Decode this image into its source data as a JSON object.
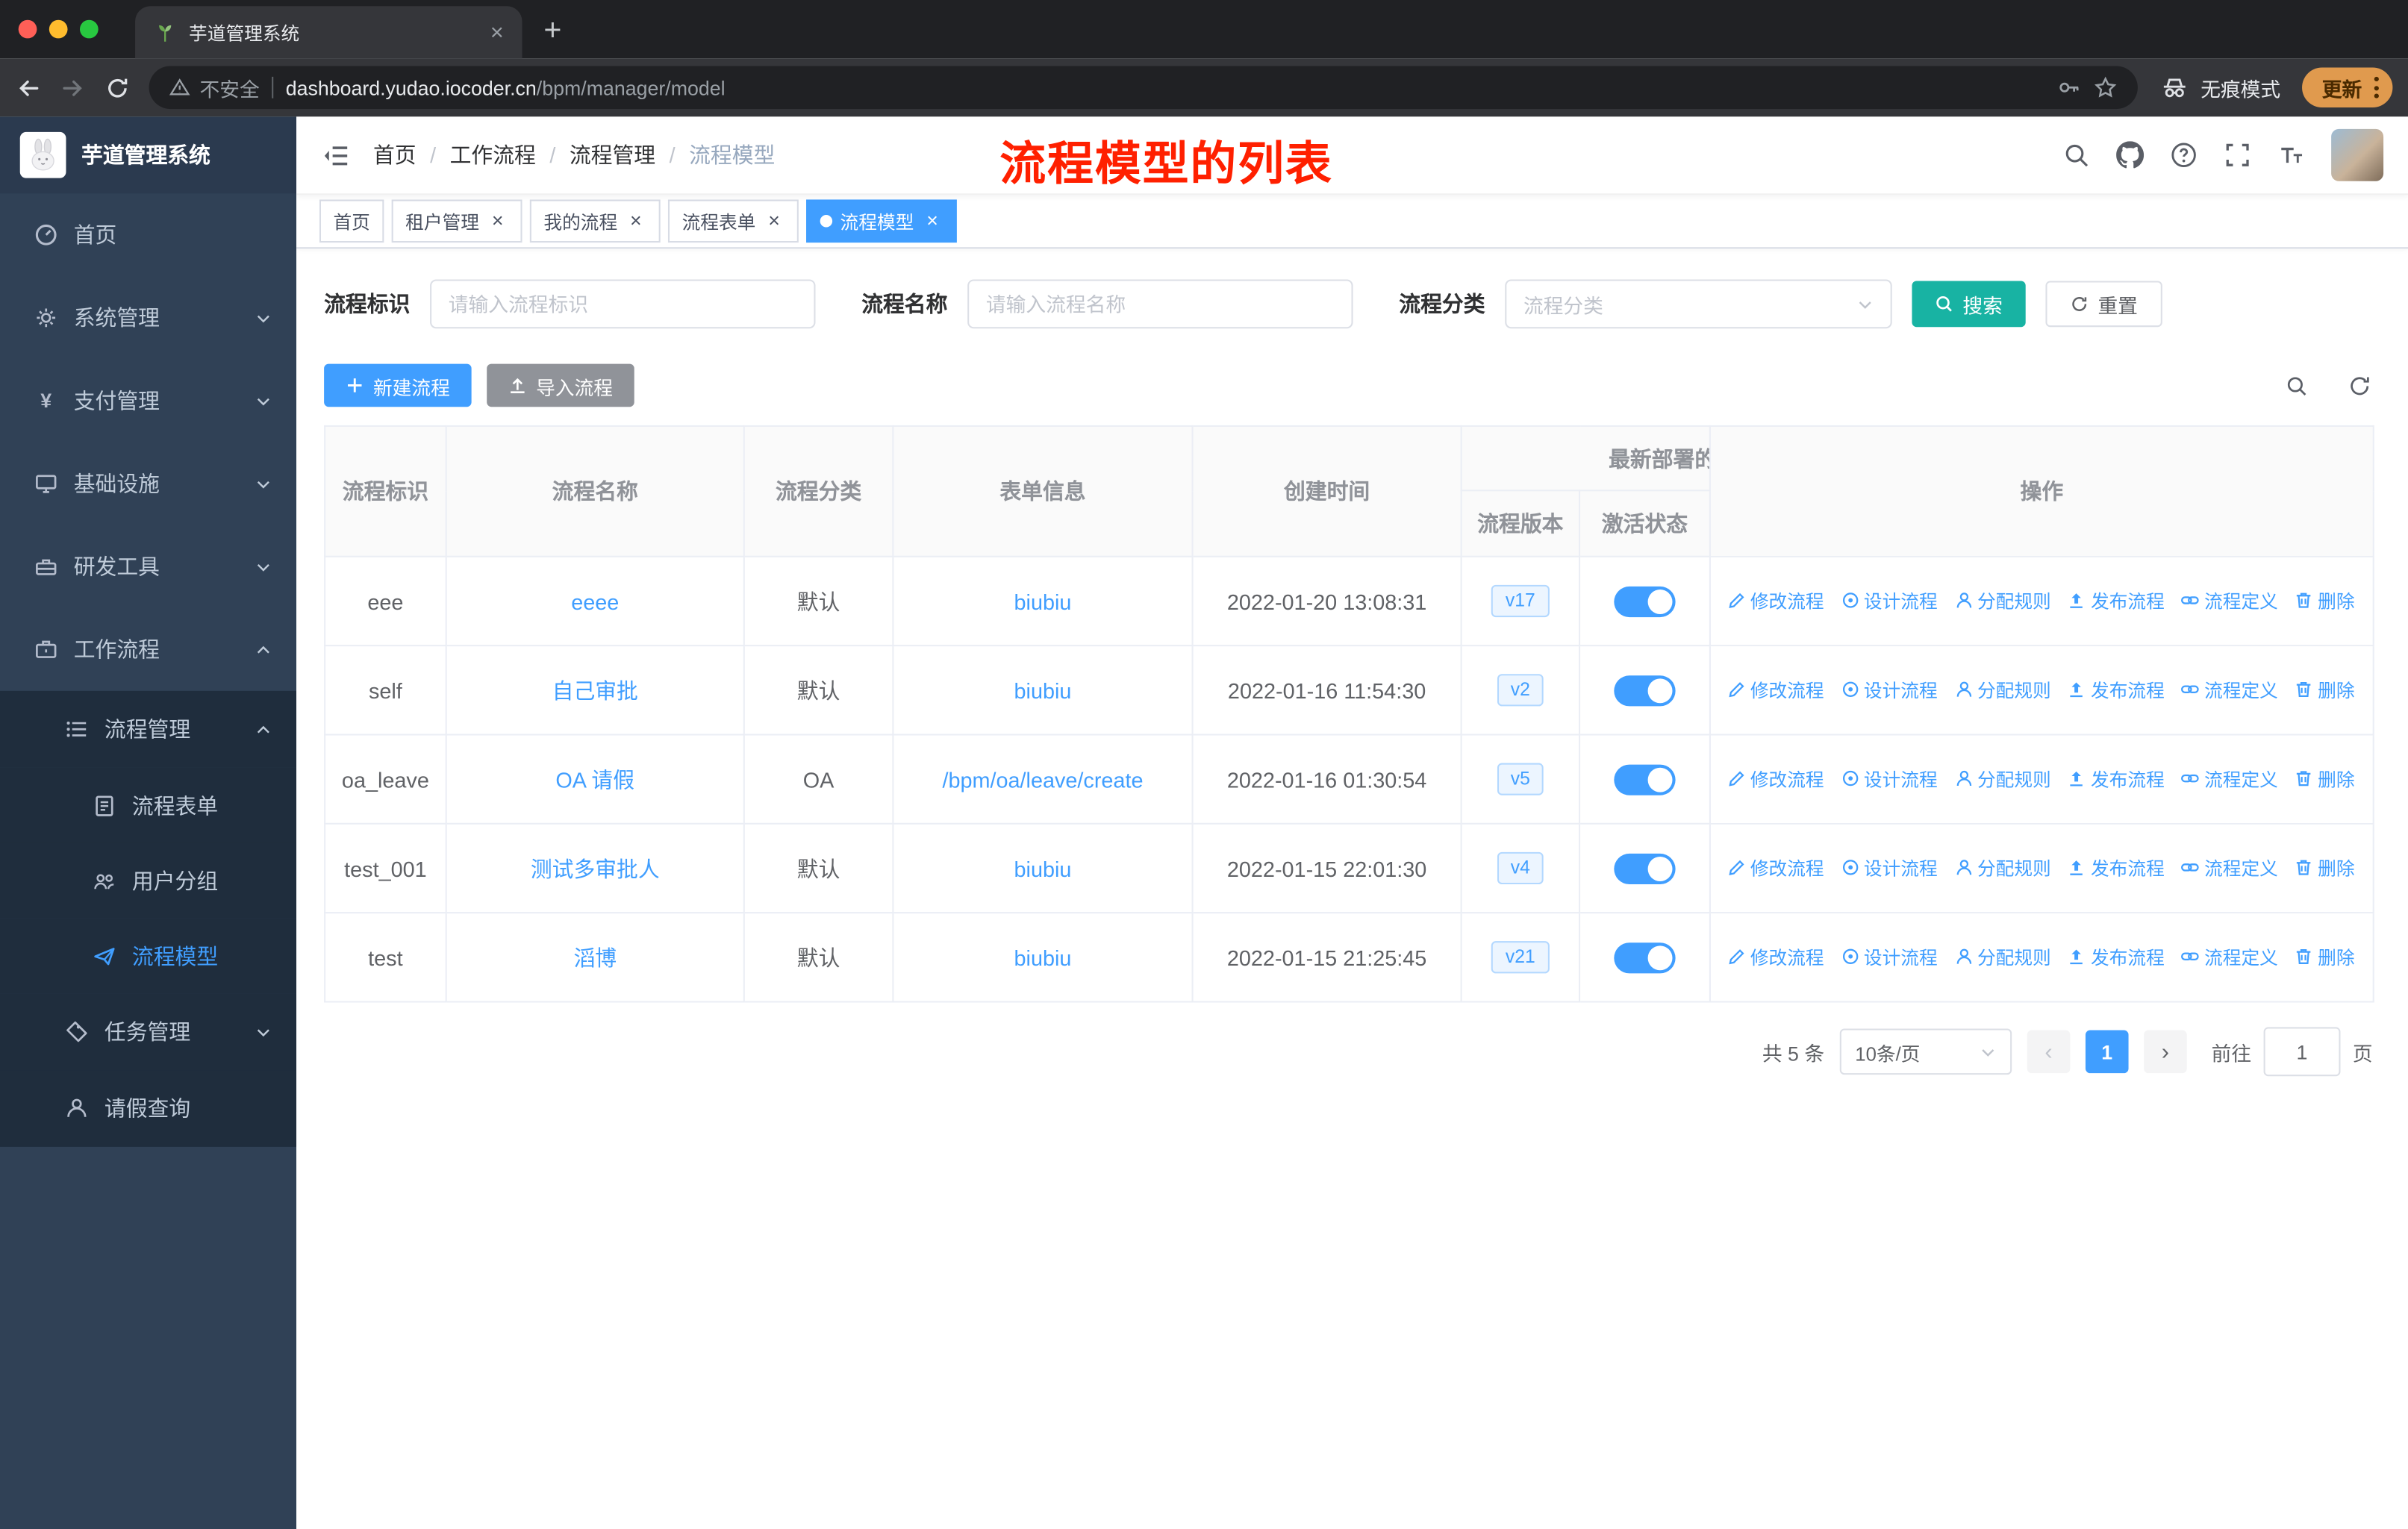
{
  "browser": {
    "tab_title": "芋道管理系统",
    "security_label": "不安全",
    "url_host": "dashboard.yudao.iocoder.cn",
    "url_path": "/bpm/manager/model",
    "incognito_label": "无痕模式",
    "update_label": "更新"
  },
  "sidebar": {
    "logo_title": "芋道管理系统",
    "items": [
      {
        "label": "首页"
      },
      {
        "label": "系统管理"
      },
      {
        "label": "支付管理"
      },
      {
        "label": "基础设施"
      },
      {
        "label": "研发工具"
      },
      {
        "label": "工作流程"
      },
      {
        "label": "流程管理"
      },
      {
        "label": "流程表单"
      },
      {
        "label": "用户分组"
      },
      {
        "label": "流程模型"
      },
      {
        "label": "任务管理"
      },
      {
        "label": "请假查询"
      }
    ]
  },
  "navbar": {
    "breadcrumb": [
      "首页",
      "工作流程",
      "流程管理",
      "流程模型"
    ],
    "annotation": "流程模型的列表"
  },
  "tags": [
    {
      "label": "首页",
      "closable": false,
      "active": false
    },
    {
      "label": "租户管理",
      "closable": true,
      "active": false
    },
    {
      "label": "我的流程",
      "closable": true,
      "active": false
    },
    {
      "label": "流程表单",
      "closable": true,
      "active": false
    },
    {
      "label": "流程模型",
      "closable": true,
      "active": true
    }
  ],
  "filter": {
    "id_label": "流程标识",
    "id_placeholder": "请输入流程标识",
    "name_label": "流程名称",
    "name_placeholder": "请输入流程名称",
    "category_label": "流程分类",
    "category_placeholder": "流程分类",
    "search_label": "搜索",
    "reset_label": "重置"
  },
  "toolbar": {
    "create_label": "新建流程",
    "import_label": "导入流程"
  },
  "table": {
    "headers": {
      "id": "流程标识",
      "name": "流程名称",
      "category": "流程分类",
      "form": "表单信息",
      "created": "创建时间",
      "group": "最新部署的",
      "version": "流程版本",
      "status": "激活状态",
      "actions": "操作"
    },
    "actions": [
      {
        "label": "修改流程",
        "icon": "edit-icon"
      },
      {
        "label": "设计流程",
        "icon": "design-icon"
      },
      {
        "label": "分配规则",
        "icon": "assign-icon"
      },
      {
        "label": "发布流程",
        "icon": "publish-icon"
      },
      {
        "label": "流程定义",
        "icon": "definition-icon"
      },
      {
        "label": "删除",
        "icon": "delete-icon"
      }
    ],
    "rows": [
      {
        "id": "eee",
        "name": "eeee",
        "category": "默认",
        "form": "biubiu",
        "created": "2022-01-20 13:08:31",
        "version": "v17",
        "active": true
      },
      {
        "id": "self",
        "name": "自己审批",
        "category": "默认",
        "form": "biubiu",
        "created": "2022-01-16 11:54:30",
        "version": "v2",
        "active": true
      },
      {
        "id": "oa_leave",
        "name": "OA 请假",
        "category": "OA",
        "form": "/bpm/oa/leave/create",
        "created": "2022-01-16 01:30:54",
        "version": "v5",
        "active": true
      },
      {
        "id": "test_001",
        "name": "测试多审批人",
        "category": "默认",
        "form": "biubiu",
        "created": "2022-01-15 22:01:30",
        "version": "v4",
        "active": true
      },
      {
        "id": "test",
        "name": "滔博",
        "category": "默认",
        "form": "biubiu",
        "created": "2022-01-15 21:25:45",
        "version": "v21",
        "active": true
      }
    ]
  },
  "pagination": {
    "total": "共 5 条",
    "page_size": "10条/页",
    "current_page": "1",
    "goto_label": "前往",
    "goto_value": "1",
    "page_unit": "页"
  },
  "colors": {
    "accent": "#409eff",
    "search_button": "#18b3a3",
    "annotation_red": "#ff2000",
    "sidebar_bg": "#304156",
    "sidebar_submenu_bg": "#1f2d3d",
    "tag_active": "#409eff",
    "toggle_on": "#409eff"
  }
}
